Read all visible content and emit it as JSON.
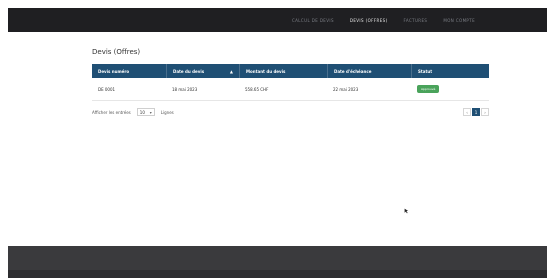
{
  "nav": {
    "items": [
      {
        "label": "CALCUL DE DEVIS",
        "active": false
      },
      {
        "label": "DEVIS (OFFRES)",
        "active": true
      },
      {
        "label": "FACTURES",
        "active": false
      },
      {
        "label": "MON COMPTE",
        "active": false
      }
    ]
  },
  "page": {
    "title": "Devis (Offres)"
  },
  "table": {
    "headers": [
      "Devis numéro",
      "Date du devis",
      "Montant du devis",
      "Date d'échéance",
      "Statut"
    ],
    "rows": [
      {
        "numero": "DE 0001",
        "date": "18 mai 2023",
        "montant": "558.65 CHF",
        "echeance": "22 mai 2023",
        "statut": "Approuvé"
      }
    ]
  },
  "footer": {
    "show_label": "Afficher les entrées",
    "page_size": "10",
    "per_page_label": "Lignes"
  },
  "pagination": {
    "prev": "‹",
    "current": "1",
    "next": "›"
  },
  "colors": {
    "accent": "#1f4f74",
    "status_ok": "#4aa35b"
  }
}
